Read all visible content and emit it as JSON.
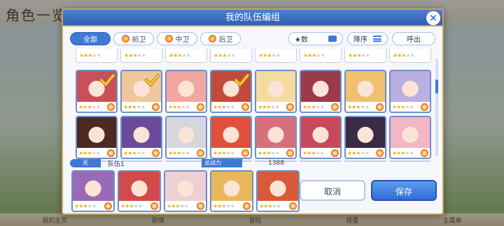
{
  "background": {
    "title": "角色一览",
    "nav_items": [
      "我的主页",
      "剧情",
      "冒险",
      "扭蛋",
      "主菜单"
    ]
  },
  "dialog": {
    "title": "我的队伍编组",
    "close_label": "×"
  },
  "filters": {
    "tabs": [
      {
        "label": "全部",
        "active": true
      },
      {
        "label": "前卫",
        "active": false
      },
      {
        "label": "中卫",
        "active": false
      },
      {
        "label": "后卫",
        "active": false
      }
    ]
  },
  "sort": {
    "star_label": "★数",
    "order_label": "降序",
    "callout_label": "呼出"
  },
  "roster": {
    "row1": [
      {
        "name": "char-1",
        "stars": 3,
        "selected": true,
        "color": "#c7505a"
      },
      {
        "name": "char-2",
        "stars": 3,
        "selected": true,
        "color": "#f0c69a"
      },
      {
        "name": "char-3",
        "stars": 3,
        "selected": false,
        "color": "#f2a8a0"
      },
      {
        "name": "char-4",
        "stars": 3,
        "selected": true,
        "color": "#c24a3a"
      },
      {
        "name": "char-5",
        "stars": 3,
        "selected": false,
        "color": "#f4dba0"
      },
      {
        "name": "char-6",
        "stars": 3,
        "selected": false,
        "color": "#9a3a4a"
      },
      {
        "name": "char-7",
        "stars": 3,
        "selected": false,
        "color": "#f0c070"
      },
      {
        "name": "char-8",
        "stars": 3,
        "selected": false,
        "color": "#bbaee0"
      }
    ],
    "row2": [
      {
        "name": "char-9",
        "stars": 3,
        "selected": false,
        "color": "#4a2a22"
      },
      {
        "name": "char-10",
        "stars": 3,
        "selected": false,
        "color": "#6a4a9a"
      },
      {
        "name": "char-11",
        "stars": 3,
        "selected": false,
        "color": "#d6d6dc"
      },
      {
        "name": "char-12",
        "stars": 3,
        "selected": false,
        "color": "#e0503a"
      },
      {
        "name": "char-13",
        "stars": 3,
        "selected": false,
        "color": "#d8707a"
      },
      {
        "name": "char-14",
        "stars": 3,
        "selected": false,
        "color": "#c84a5a"
      },
      {
        "name": "char-15",
        "stars": 3,
        "selected": false,
        "color": "#3a2a44"
      },
      {
        "name": "char-16",
        "stars": 3,
        "selected": false,
        "color": "#f2b6c6"
      }
    ]
  },
  "team": {
    "slot_label": "无",
    "team_name": "队伍1",
    "power_label": "总战力",
    "power_value": "1388",
    "members": [
      {
        "name": "member-1",
        "stars": 3,
        "color": "#9a6ab8"
      },
      {
        "name": "member-2",
        "stars": 3,
        "color": "#d24a4a"
      },
      {
        "name": "member-3",
        "stars": 3,
        "color": "#eecfd2"
      },
      {
        "name": "member-4",
        "stars": 3,
        "color": "#e8b85a"
      },
      {
        "name": "member-5",
        "stars": 3,
        "color": "#d85a3a"
      }
    ]
  },
  "actions": {
    "cancel_label": "取消",
    "save_label": "保存"
  }
}
